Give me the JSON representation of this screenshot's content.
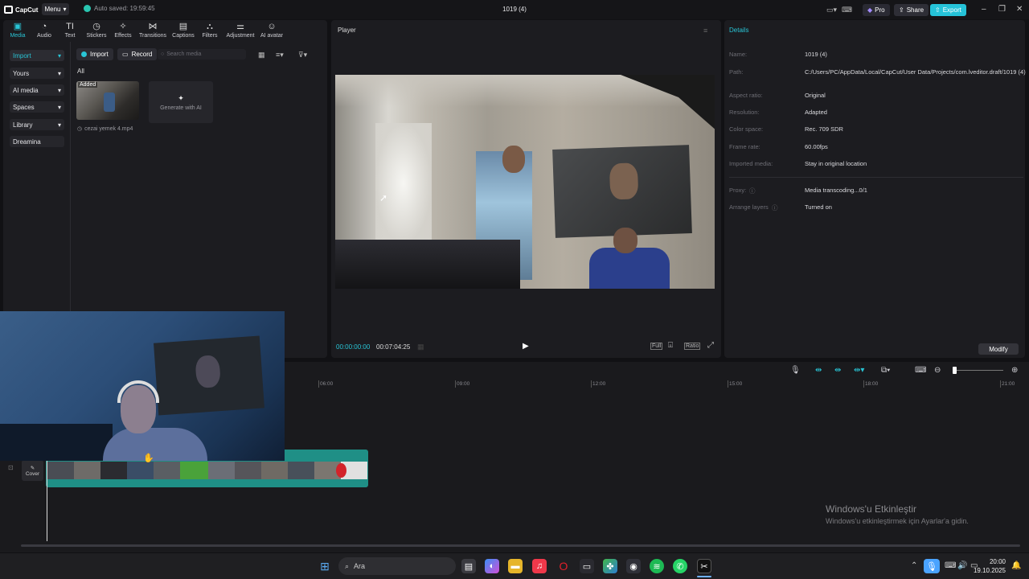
{
  "app": {
    "logo_text": "CapCut",
    "menu_label": "Menu",
    "autosave_text": "Auto saved: 19:59:45",
    "window_title": "1019 (4)",
    "pro_label": "Pro",
    "share_label": "Share",
    "export_label": "Export",
    "accent_color": "#29c5d6"
  },
  "toolbar": {
    "tabs": [
      {
        "label": "Media",
        "icon": "media-icon"
      },
      {
        "label": "Audio",
        "icon": "audio-icon"
      },
      {
        "label": "Text",
        "icon": "text-icon"
      },
      {
        "label": "Stickers",
        "icon": "stickers-icon"
      },
      {
        "label": "Effects",
        "icon": "effects-icon"
      },
      {
        "label": "Transitions",
        "icon": "transitions-icon"
      },
      {
        "label": "Captions",
        "icon": "captions-icon"
      },
      {
        "label": "Filters",
        "icon": "filters-icon"
      },
      {
        "label": "Adjustment",
        "icon": "adjustment-icon"
      },
      {
        "label": "AI avatar",
        "icon": "ai-avatar-icon"
      }
    ]
  },
  "sidebar": {
    "items": [
      {
        "label": "Import"
      },
      {
        "label": "Yours"
      },
      {
        "label": "AI media"
      },
      {
        "label": "Spaces"
      },
      {
        "label": "Library"
      },
      {
        "label": "Dreamina"
      }
    ]
  },
  "media": {
    "import_label": "Import",
    "record_label": "Record",
    "search_placeholder": "Search media",
    "filter_all": "All",
    "clip_badge": "Added",
    "clip_name": "cezai yemek 4.mp4",
    "generate_label": "Generate with AI"
  },
  "player": {
    "title": "Player",
    "current_time": "00:00:00:00",
    "total_time": "00:07:04:25",
    "full_label": "Full",
    "ratio_label": "Ratio"
  },
  "details": {
    "title": "Details",
    "rows": [
      {
        "key": "Name:",
        "value": "1019 (4)"
      },
      {
        "key": "Path:",
        "value": "C:/Users/PC/AppData/Local/CapCut/User Data/Projects/com.lveditor.draft/1019 (4)"
      },
      {
        "key": "Aspect ratio:",
        "value": "Original"
      },
      {
        "key": "Resolution:",
        "value": "Adapted"
      },
      {
        "key": "Color space:",
        "value": "Rec. 709 SDR"
      },
      {
        "key": "Frame rate:",
        "value": "60.00fps"
      },
      {
        "key": "Imported media:",
        "value": "Stay in original location"
      },
      {
        "key": "Proxy:",
        "value": "Media transcoding...0/1"
      },
      {
        "key": "Arrange layers",
        "value": "Turned on"
      }
    ],
    "modify_label": "Modify"
  },
  "timeline": {
    "ticks": [
      "06:00",
      "09:00",
      "12:00",
      "15:00",
      "18:00",
      "21:00"
    ],
    "cover_label": "Cover"
  },
  "watermark": {
    "line1": "Windows'u Etkinleştir",
    "line2": "Windows'u etkinleştirmek için Ayarlar'a gidin."
  },
  "taskbar": {
    "search_placeholder": "Ara",
    "time": "20:00",
    "date": "19.10.2025"
  }
}
